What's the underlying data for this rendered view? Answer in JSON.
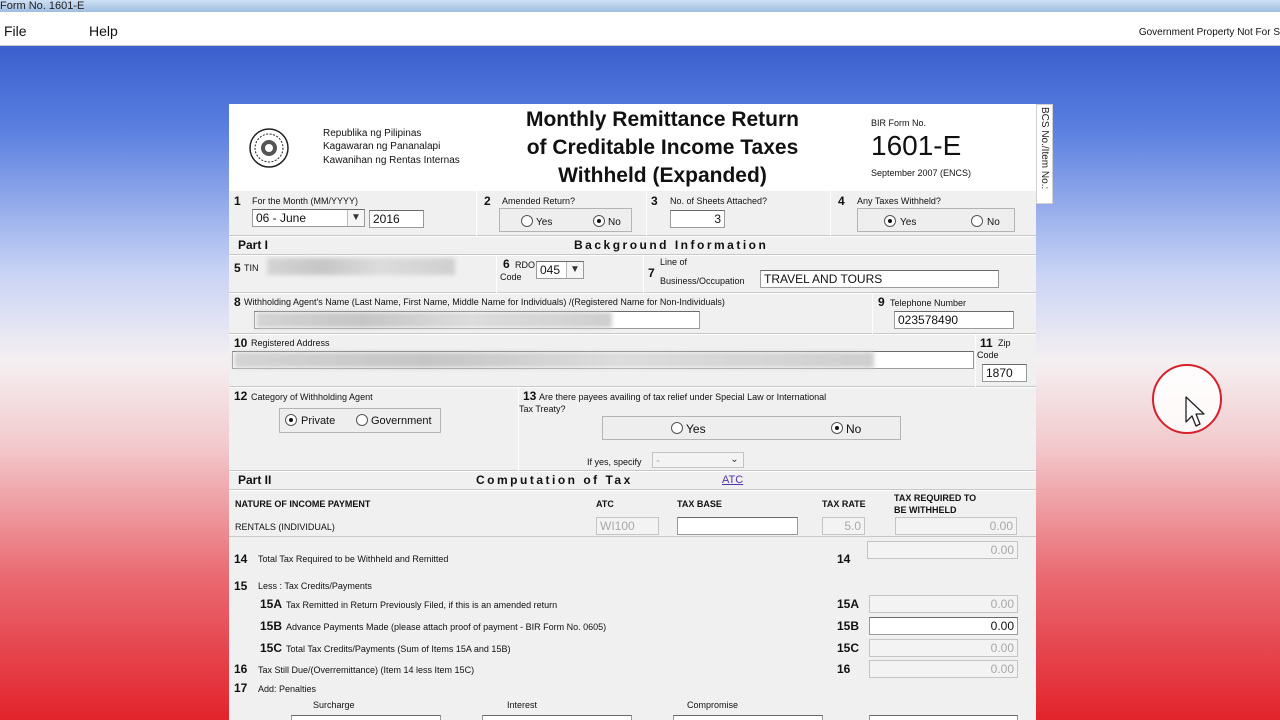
{
  "window": {
    "title": "Form No. 1601-E"
  },
  "menu": {
    "file": "File",
    "help": "Help",
    "notice": "Government Property Not For S"
  },
  "header": {
    "agency_line1": "Republika ng Pilipinas",
    "agency_line2": "Kagawaran ng Pananalapi",
    "agency_line3": "Kawanihan ng Rentas Internas",
    "title_line1": "Monthly Remittance Return",
    "title_line2": "of Creditable Income Taxes",
    "title_line3": "Withheld (Expanded)",
    "form_label": "BIR Form No.",
    "form_number": "1601-E",
    "form_version": "September 2007 (ENCS)",
    "side_tab": "BCS No./Item No.:"
  },
  "row1": {
    "n1": "1",
    "month_label": "For the Month (MM/YYYY)",
    "month_value": "06 - June",
    "year_value": "2016",
    "n2": "2",
    "amended_label": "Amended Return?",
    "yes": "Yes",
    "no": "No",
    "n3": "3",
    "sheets_label": "No. of Sheets Attached?",
    "sheets_value": "3",
    "n4": "4",
    "taxes_label": "Any Taxes Withheld?"
  },
  "part1": {
    "part": "Part I",
    "title": "Background Information",
    "n5": "5",
    "tin_label": "TIN",
    "n6": "6",
    "rdo_label1": "RDO",
    "rdo_label2": "Code",
    "rdo_value": "045",
    "n7": "7",
    "line_label1": "Line of",
    "line_label2": "Business/Occupation",
    "line_value": "TRAVEL AND TOURS",
    "n8": "8",
    "agent_name_label": "Withholding Agent's Name (Last Name, First Name, Middle Name for Individuals) /(Registered Name for Non-Individuals)",
    "n9": "9",
    "phone_label": "Telephone Number",
    "phone_value": "023578490",
    "n10": "10",
    "address_label": "Registered Address",
    "n11": "11",
    "zip_label1": "Zip",
    "zip_label2": "Code",
    "zip_value": "1870",
    "n12": "12",
    "category_label": "Category of Withholding Agent",
    "private": "Private",
    "government": "Government",
    "n13": "13",
    "treaty_label1": "Are there payees availing of tax relief under Special Law or International",
    "treaty_label2": "Tax Treaty?",
    "yes": "Yes",
    "no": "No",
    "specify_label": "If yes, specify",
    "specify_value": "-"
  },
  "part2": {
    "part": "Part II",
    "title": "Computation of Tax",
    "atc_link": "ATC",
    "col_nature": "NATURE OF INCOME PAYMENT",
    "col_atc": "ATC",
    "col_base": "TAX BASE",
    "col_rate": "TAX RATE",
    "col_required1": "TAX REQUIRED TO",
    "col_required2": "BE WITHHELD",
    "row_nature": "RENTALS (INDIVIDUAL)",
    "row_atc": "WI100",
    "row_base": "",
    "row_rate": "5.0",
    "row_required": "0.00",
    "n14": "14",
    "l14": "Total Tax Required to be Withheld and Remitted",
    "v14": "0.00",
    "n15": "15",
    "l15": "Less : Tax Credits/Payments",
    "n15a": "15A",
    "l15a": "Tax Remitted in Return Previously Filed, if this is an amended return",
    "v15a": "0.00",
    "n15b": "15B",
    "l15b": "Advance Payments Made (please attach proof of payment - BIR Form No. 0605)",
    "v15b": "0.00",
    "n15c": "15C",
    "l15c": "Total Tax Credits/Payments (Sum of Items 15A and 15B)",
    "v15c": "0.00",
    "n16": "16",
    "l16": "Tax Still Due/(Overremittance) (Item 14 less Item 15C)",
    "v16": "0.00",
    "n17": "17",
    "l17": "Add: Penalties",
    "surcharge": "Surcharge",
    "interest": "Interest",
    "compromise": "Compromise"
  }
}
